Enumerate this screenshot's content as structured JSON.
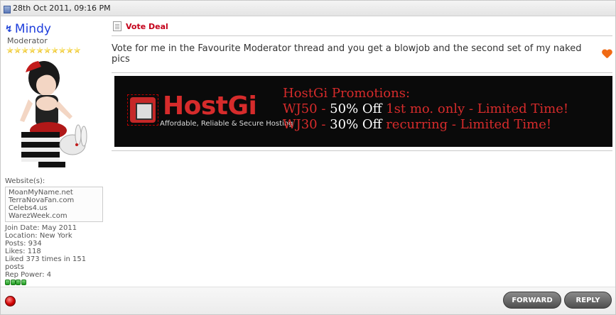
{
  "post": {
    "date": "28th Oct 2011, 09:16 PM",
    "title": "Vote Deal",
    "message": "Vote for me in the Favourite Moderator thread and you get a blowjob and the second set of my naked pics",
    "icons": {
      "post_date": "post-icon",
      "title_doc": "document-icon",
      "heart": "heart-icon",
      "online": "online-status-icon",
      "status": "offline-status-icon"
    }
  },
  "user": {
    "name": "Mindy",
    "title": "Moderator",
    "stars": 10,
    "websites_label": "Website(s):",
    "websites": [
      "MoanMyName.net",
      "TerraNovaFan.com",
      "Celebs4.us",
      "WarezWeek.com"
    ],
    "stats": {
      "join_date": "Join Date: May 2011",
      "location": "Location: New York",
      "posts": "Posts: 934",
      "likes": "Likes: 118",
      "liked": "Liked 373 times in 151 posts",
      "rep_power": "Rep Power: 4"
    },
    "rep_pips": 4
  },
  "banner": {
    "brand": "HostGi",
    "tagline": "Affordable, Reliable & Secure Hosting",
    "promo_title": "HostGi Promotions:",
    "line1_code": "WJ50 -",
    "line1_offer": "50% Off",
    "line1_rest": "1st mo. only  - Limited Time!",
    "line2_code": "WJ30 -",
    "line2_offer": "30% Off",
    "line2_rest": "recurring - Limited Time!"
  },
  "actions": {
    "forward": "FORWARD",
    "reply": "REPLY"
  },
  "colors": {
    "username": "#1f3fdc",
    "title_red": "#c4001a",
    "banner_red": "#d62b2b",
    "button_grey": "#5a5a5a"
  }
}
